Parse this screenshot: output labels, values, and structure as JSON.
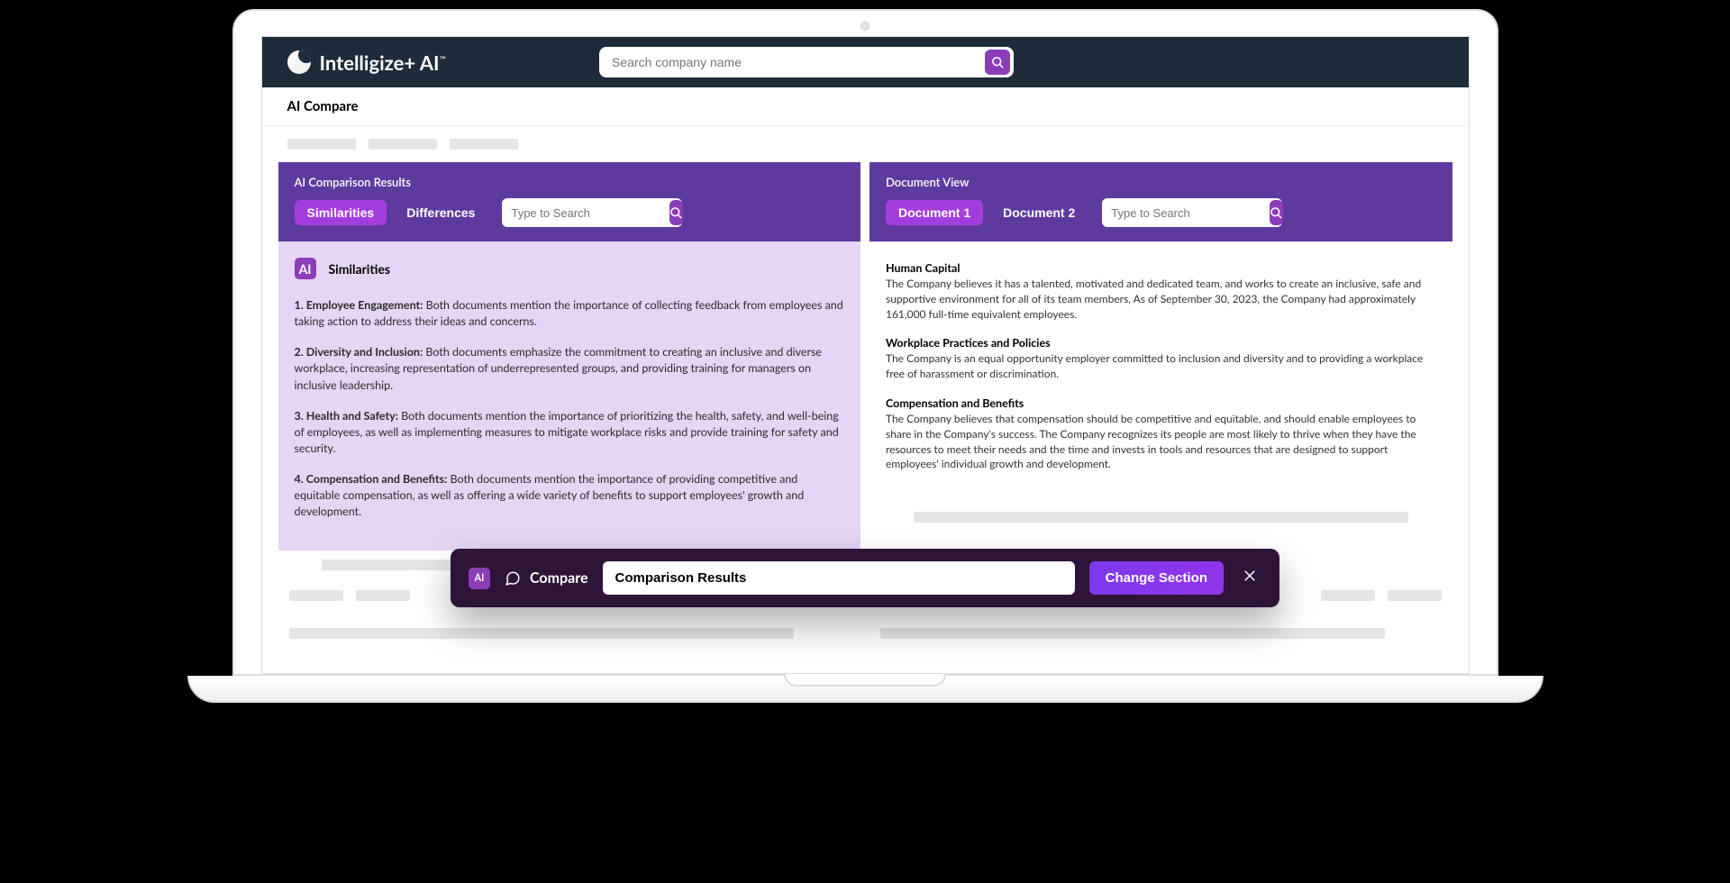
{
  "brand": "Intelligize+ AI",
  "header_search": {
    "placeholder": "Search company name"
  },
  "subheader": "AI Compare",
  "left": {
    "title": "AI Comparison Results",
    "tabs": {
      "similarities": "Similarities",
      "differences": "Differences"
    },
    "search_placeholder": "Type to Search",
    "body_heading": "Similarities",
    "items": [
      {
        "num": "1. Employee Engagement:",
        "text": " Both documents mention the importance of collecting feedback from employees and taking action to address their ideas and concerns."
      },
      {
        "num": "2. Diversity and Inclusion:",
        "text": " Both documents emphasize the commitment to creating an inclusive and diverse workplace, increasing representation of underrepresented groups, and providing training for managers on inclusive leadership."
      },
      {
        "num": "3. Health and Safety:",
        "text": " Both documents mention the importance of prioritizing the health, safety, and well-being of employees, as well as implementing measures to mitigate workplace risks and provide training for safety and security."
      },
      {
        "num": "4. Compensation and Benefits:",
        "text": " Both documents mention the importance of providing competitive and equitable compensation, as well as offering a wide variety of benefits to support employees' growth and development."
      }
    ]
  },
  "right": {
    "title": "Document View",
    "tabs": {
      "doc1": "Document 1",
      "doc2": "Document 2"
    },
    "search_placeholder": "Type to Search",
    "sections": [
      {
        "h": "Human Capital",
        "p": "The Company believes it has a talented, motivated and dedicated team, and works to create an inclusive, safe and supportive environment for all of its team members, As of September 30, 2023, the Company had approximately 161,000 full-time equivalent employees."
      },
      {
        "h": "Workplace Practices and Policies",
        "p": "The Company is an equal opportunity employer committed to inclusion and diversity and to providing a workplace free of harassment or discrimination."
      },
      {
        "h": "Compensation and Benefits",
        "p": "The Company believes that compensation should be competitive and equitable, and should enable employees to share in the Company's success. The Company recognizes its people are most likely to thrive when they have the resources to meet their needs and the time and invests in tools and resources that are designed to support employees' individual growth and development."
      }
    ]
  },
  "floating": {
    "badge": "AI",
    "label": "Compare",
    "input_value": "Comparison Results",
    "change_btn": "Change Section"
  }
}
